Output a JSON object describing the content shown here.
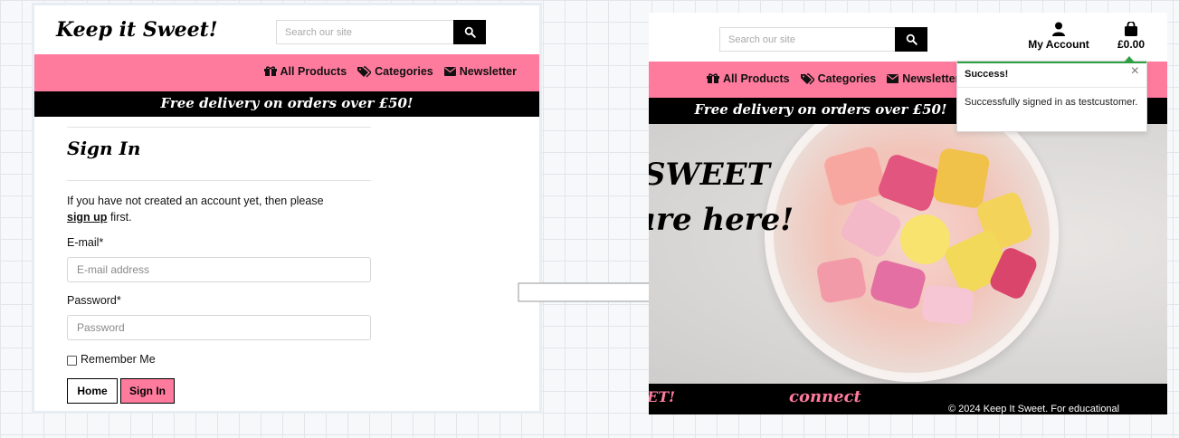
{
  "brand": "Keep it Sweet!",
  "search": {
    "placeholder": "Search our site"
  },
  "nav": {
    "all_products": "All Products",
    "categories": "Categories",
    "newsletter": "Newsletter"
  },
  "banner": "Free delivery on orders over £50!",
  "signin": {
    "title": "Sign In",
    "intro_text": "If you have not created an account yet, then please",
    "signup_link": "sign up",
    "intro_suffix": "first.",
    "email_label": "E-mail*",
    "email_placeholder": "E-mail address",
    "password_label": "Password*",
    "password_placeholder": "Password",
    "remember_label": "Remember Me",
    "home_button": "Home",
    "signin_button": "Sign In"
  },
  "account": {
    "label": "My Account"
  },
  "bag": {
    "total": "£0.00"
  },
  "toast": {
    "title": "Success!",
    "close": "×",
    "message": "Successfully signed in as testcustomer."
  },
  "hero": {
    "line1": "SWEET",
    "line2": "are here!"
  },
  "footer": {
    "left": "ET!",
    "connect": "connect",
    "copyright": "© 2024 Keep It Sweet. For educational"
  },
  "colors": {
    "brand_pink": "#ff7b9e",
    "black": "#000000",
    "success_green": "#2ea043"
  }
}
